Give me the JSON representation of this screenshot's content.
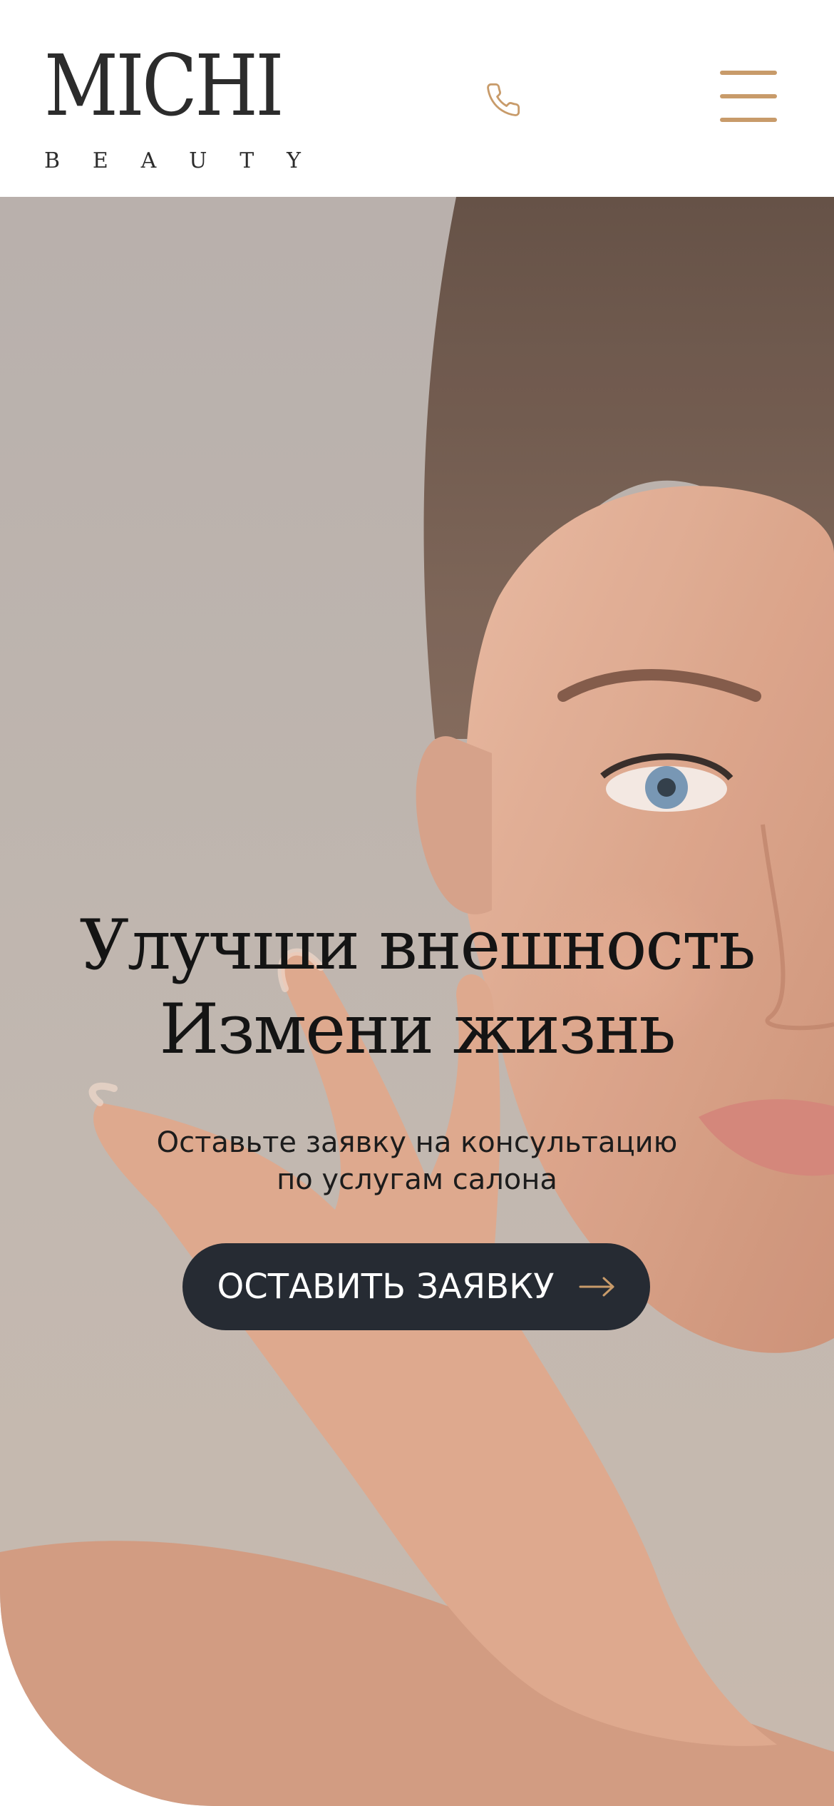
{
  "header": {
    "logo": {
      "main": "MICHI",
      "sub_letters": [
        "B",
        "E",
        "A",
        "U",
        "T",
        "Y"
      ]
    },
    "phone_icon": "phone-icon",
    "menu_icon": "hamburger-menu-icon"
  },
  "hero": {
    "title_lines": [
      "Улучши внешность",
      "Измени жизнь"
    ],
    "subtitle_lines": [
      "Оставьте заявку на консультацию",
      "по услугам салона"
    ],
    "cta": {
      "label": "ОСТАВИТЬ ЗАЯВКУ",
      "icon": "arrow-right-icon"
    },
    "image": "woman-face-photo"
  },
  "colors": {
    "accent": "#c89b6a",
    "dark": "#262b33",
    "text": "#141414",
    "logo": "#2c2c2c",
    "background": "#ffffff"
  }
}
